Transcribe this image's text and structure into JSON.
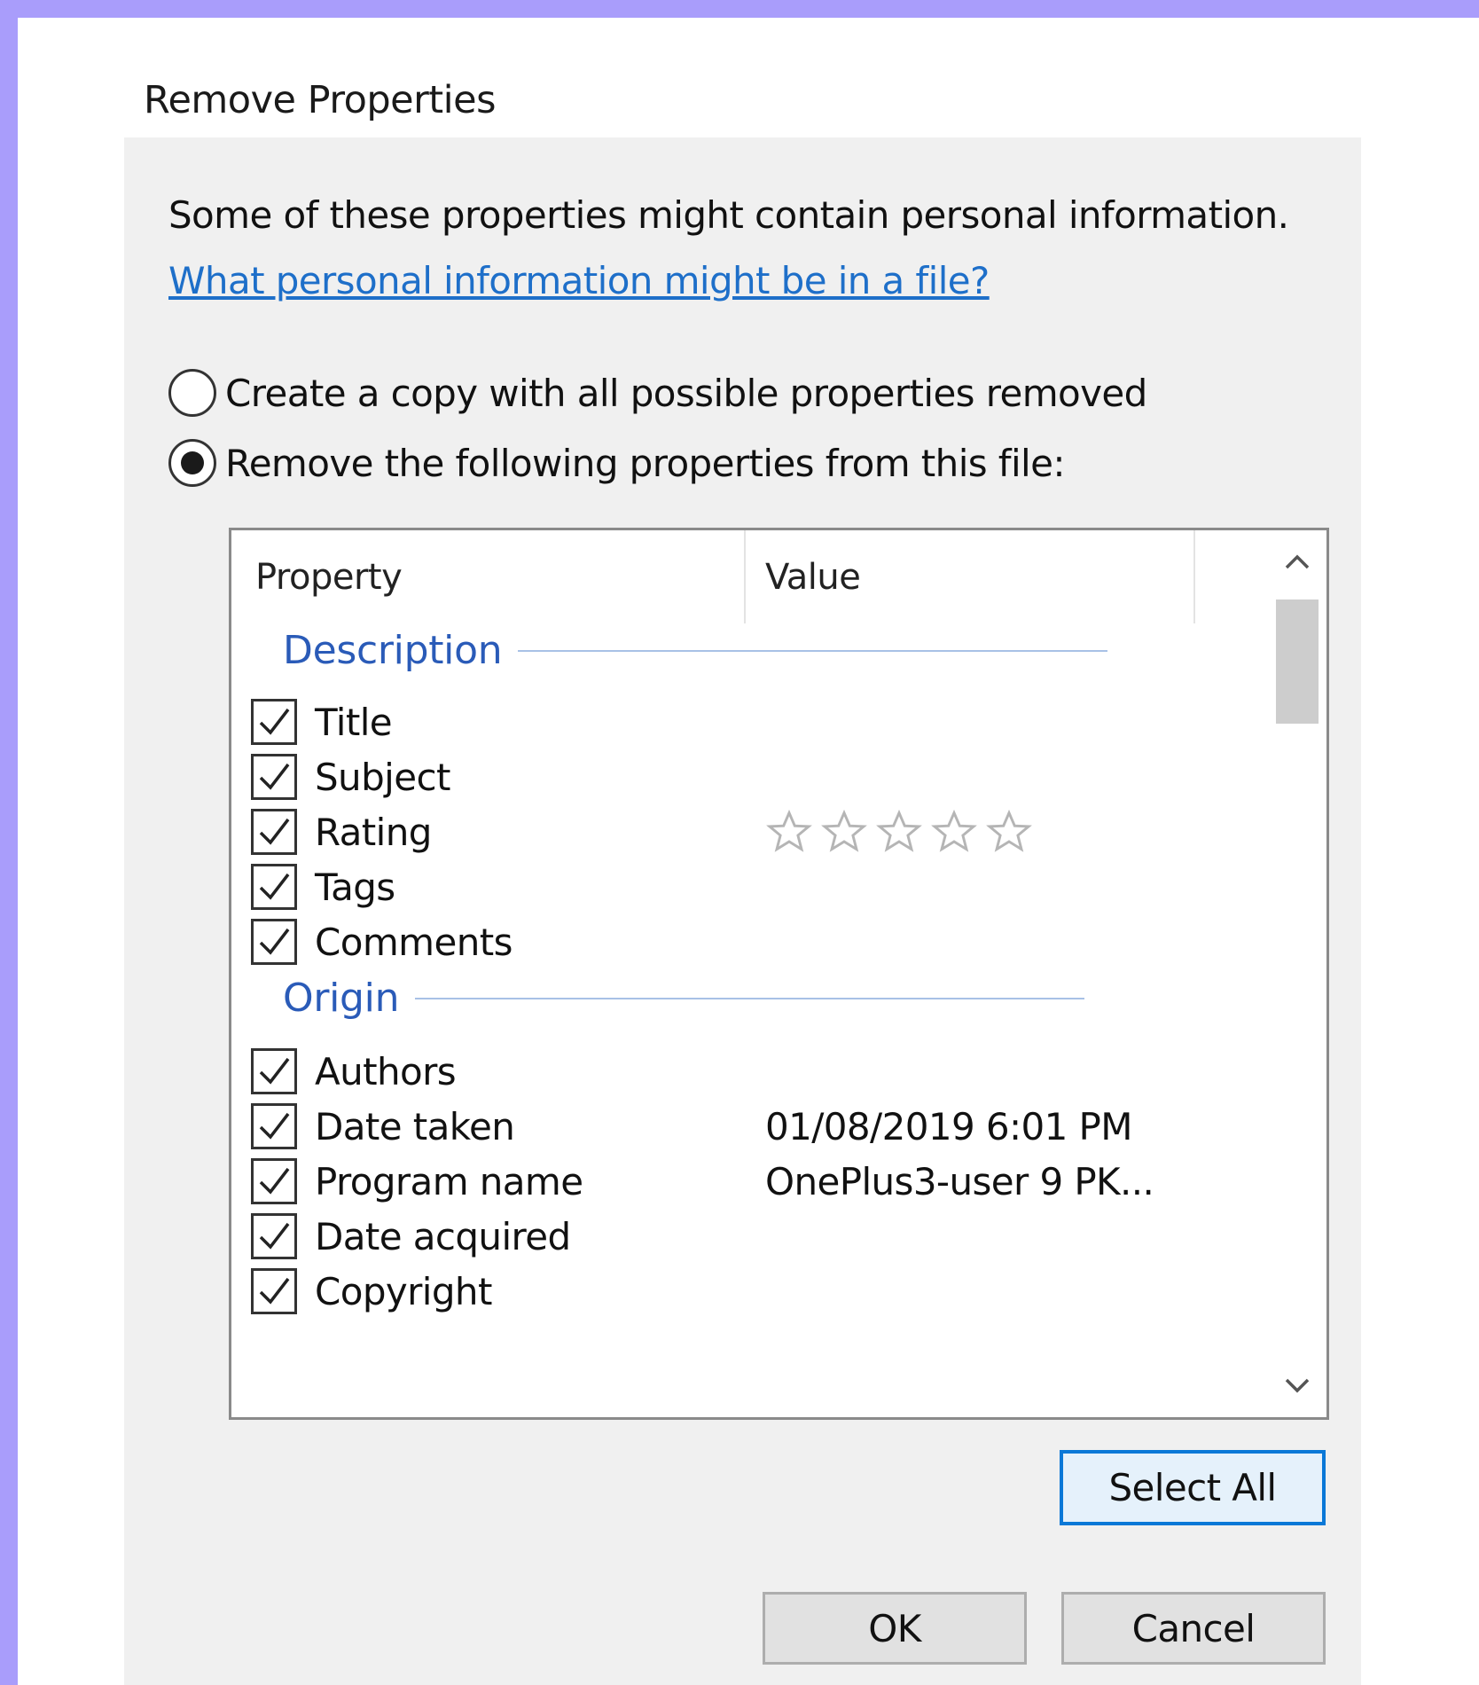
{
  "window": {
    "title": "Remove Properties"
  },
  "dialog": {
    "info_text": "Some of these properties might contain personal information.",
    "help_link": "What personal information might be in a file?",
    "options": [
      {
        "label": "Create a copy with all possible properties removed",
        "selected": false
      },
      {
        "label": "Remove the following properties from this file:",
        "selected": true
      }
    ]
  },
  "property_list": {
    "columns": {
      "property": "Property",
      "value": "Value"
    },
    "groups": [
      {
        "name": "Description",
        "items": [
          {
            "label": "Title",
            "value": "",
            "checked": true
          },
          {
            "label": "Subject",
            "value": "",
            "checked": true
          },
          {
            "label": "Rating",
            "value": "",
            "rating": 0,
            "rating_max": 5,
            "checked": true
          },
          {
            "label": "Tags",
            "value": "",
            "checked": true
          },
          {
            "label": "Comments",
            "value": "",
            "checked": true
          }
        ]
      },
      {
        "name": "Origin",
        "items": [
          {
            "label": "Authors",
            "value": "",
            "checked": true
          },
          {
            "label": "Date taken",
            "value": "01/08/2019 6:01 PM",
            "checked": true
          },
          {
            "label": "Program name",
            "value": "OnePlus3-user 9 PK...",
            "checked": true
          },
          {
            "label": "Date acquired",
            "value": "",
            "checked": true
          },
          {
            "label": "Copyright",
            "value": "",
            "checked": true
          }
        ]
      }
    ]
  },
  "buttons": {
    "select_all": "Select All",
    "ok": "OK",
    "cancel": "Cancel"
  },
  "colors": {
    "background": "#a99dfb",
    "link": "#1e6fc9",
    "group_header": "#2a5bb8",
    "focus_border": "#0a78d7"
  },
  "icons": {
    "checkbox": "checkmark-icon",
    "rating": "star-outline-icon",
    "scroll_up": "chevron-up-icon",
    "scroll_down": "chevron-down-icon"
  }
}
